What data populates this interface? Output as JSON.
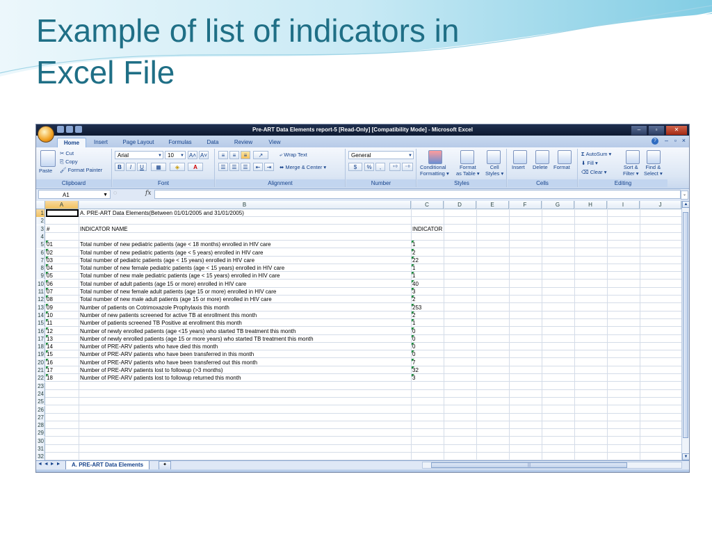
{
  "slide": {
    "title_line1": "Example of list of indicators in",
    "title_line2": "Excel File"
  },
  "window": {
    "title": "Pre-ART Data Elements report-5  [Read-Only]  [Compatibility Mode] - Microsoft Excel",
    "controls": [
      "–",
      "▫",
      "✕"
    ]
  },
  "ribbon_tabs": [
    "Home",
    "Insert",
    "Page Layout",
    "Formulas",
    "Data",
    "Review",
    "View"
  ],
  "ribbon": {
    "clipboard": {
      "paste": "Paste",
      "cut": "Cut",
      "copy": "Copy",
      "format_painter": "Format Painter",
      "label": "Clipboard"
    },
    "font": {
      "name": "Arial",
      "size": "10",
      "grow": "A˄",
      "shrink": "A˅",
      "bold": "B",
      "italic": "I",
      "underline": "U",
      "label": "Font"
    },
    "alignment": {
      "wrap_text": "Wrap Text",
      "merge_center": "Merge & Center",
      "label": "Alignment"
    },
    "number": {
      "format": "General",
      "currency": "$",
      "percent": "%",
      "comma": ",",
      "label": "Number"
    },
    "styles": {
      "conditional": "Conditional",
      "conditional2": "Formatting",
      "format_as": "Format",
      "format_as2": "as Table",
      "cell": "Cell",
      "cell2": "Styles",
      "label": "Styles"
    },
    "cells": {
      "insert": "Insert",
      "delete": "Delete",
      "format": "Format",
      "label": "Cells"
    },
    "editing": {
      "autosum": "AutoSum",
      "fill": "Fill",
      "clear": "Clear",
      "sort": "Sort &",
      "sort2": "Filter",
      "find": "Find &",
      "find2": "Select",
      "label": "Editing"
    }
  },
  "formula_bar": {
    "name_box": "A1",
    "fx": "fx",
    "content": ""
  },
  "columns": [
    "A",
    "B",
    "C",
    "D",
    "E",
    "F",
    "G",
    "H",
    "I",
    "J"
  ],
  "sheet_rows": [
    {
      "n": "1",
      "a": "",
      "b": "A. PRE-ART Data Elements(Between 01/01/2005 and 31/01/2005)",
      "c": ""
    },
    {
      "n": "2",
      "a": "",
      "b": "",
      "c": ""
    },
    {
      "n": "3",
      "a": "#",
      "b": "INDICATOR NAME",
      "c": "INDICATOR"
    },
    {
      "n": "4",
      "a": "",
      "b": "",
      "c": ""
    },
    {
      "n": "5",
      "a": "01",
      "b": "Total number of new pediatric patients (age < 18 months) enrolled in HIV care",
      "c": "1"
    },
    {
      "n": "6",
      "a": "02",
      "b": "Total number of new pediatric patients (age < 5 years) enrolled in HIV care",
      "c": "2"
    },
    {
      "n": "7",
      "a": "03",
      "b": "Total number of pediatric patients (age < 15 years) enrolled in HIV care",
      "c": "22"
    },
    {
      "n": "8",
      "a": "04",
      "b": "Total number of new female pediatric patients (age < 15 years) enrolled in HIV care",
      "c": "1"
    },
    {
      "n": "9",
      "a": "05",
      "b": "Total number of new male pediatric patients (age < 15 years) enrolled in HIV care",
      "c": "1"
    },
    {
      "n": "10",
      "a": "06",
      "b": "Total number of adult patients (age 15 or more) enrolled in HIV care",
      "c": "40"
    },
    {
      "n": "11",
      "a": "07",
      "b": "Total number of new female adult patients (age 15 or more) enrolled in HIV care",
      "c": "3"
    },
    {
      "n": "12",
      "a": "08",
      "b": "Total number of new male adult patients (age 15 or more) enrolled in HIV care",
      "c": "2"
    },
    {
      "n": "13",
      "a": "09",
      "b": "Number of patients on Cotrimoxazole Prophylaxis this month",
      "c": "253"
    },
    {
      "n": "14",
      "a": "10",
      "b": "Number of new patients screened for active TB at enrollment this month",
      "c": "2"
    },
    {
      "n": "15",
      "a": "11",
      "b": "Number of patients screened TB Positive at enrollment this month",
      "c": "1"
    },
    {
      "n": "16",
      "a": "12",
      "b": "Number of newly enrolled patients (age <15 years) who started TB treatment this month",
      "c": "0"
    },
    {
      "n": "17",
      "a": "13",
      "b": "Number of newly enrolled patients (age 15 or more years) who started TB treatment this month",
      "c": "0"
    },
    {
      "n": "18",
      "a": "14",
      "b": "Number of PRE-ARV patients who have died this month",
      "c": "0"
    },
    {
      "n": "19",
      "a": "15",
      "b": "Number of PRE-ARV patients who have been transferred in this month",
      "c": "0"
    },
    {
      "n": "20",
      "a": "16",
      "b": "Number of PRE-ARV patients who have been transferred out this month",
      "c": "7"
    },
    {
      "n": "21",
      "a": "17",
      "b": "Number of PRE-ARV patients lost to followup (>3 months)",
      "c": "32"
    },
    {
      "n": "22",
      "a": "18",
      "b": "Number of PRE-ARV patients lost to followup returned this month",
      "c": "3"
    },
    {
      "n": "23",
      "a": "",
      "b": "",
      "c": ""
    },
    {
      "n": "24",
      "a": "",
      "b": "",
      "c": ""
    },
    {
      "n": "25",
      "a": "",
      "b": "",
      "c": ""
    },
    {
      "n": "26",
      "a": "",
      "b": "",
      "c": ""
    },
    {
      "n": "27",
      "a": "",
      "b": "",
      "c": ""
    },
    {
      "n": "28",
      "a": "",
      "b": "",
      "c": ""
    },
    {
      "n": "29",
      "a": "",
      "b": "",
      "c": ""
    },
    {
      "n": "30",
      "a": "",
      "b": "",
      "c": ""
    },
    {
      "n": "31",
      "a": "",
      "b": "",
      "c": ""
    },
    {
      "n": "32",
      "a": "",
      "b": "",
      "c": ""
    }
  ],
  "sheet_tabs": {
    "active": "A. PRE-ART Data Elements",
    "nav": "◄ ◄ ► ►"
  },
  "colors": {
    "title": "#1f6f86",
    "titlebar": "#1a2743",
    "ribbon": "#dbe6f4",
    "selected_header": "#f1c15f"
  }
}
